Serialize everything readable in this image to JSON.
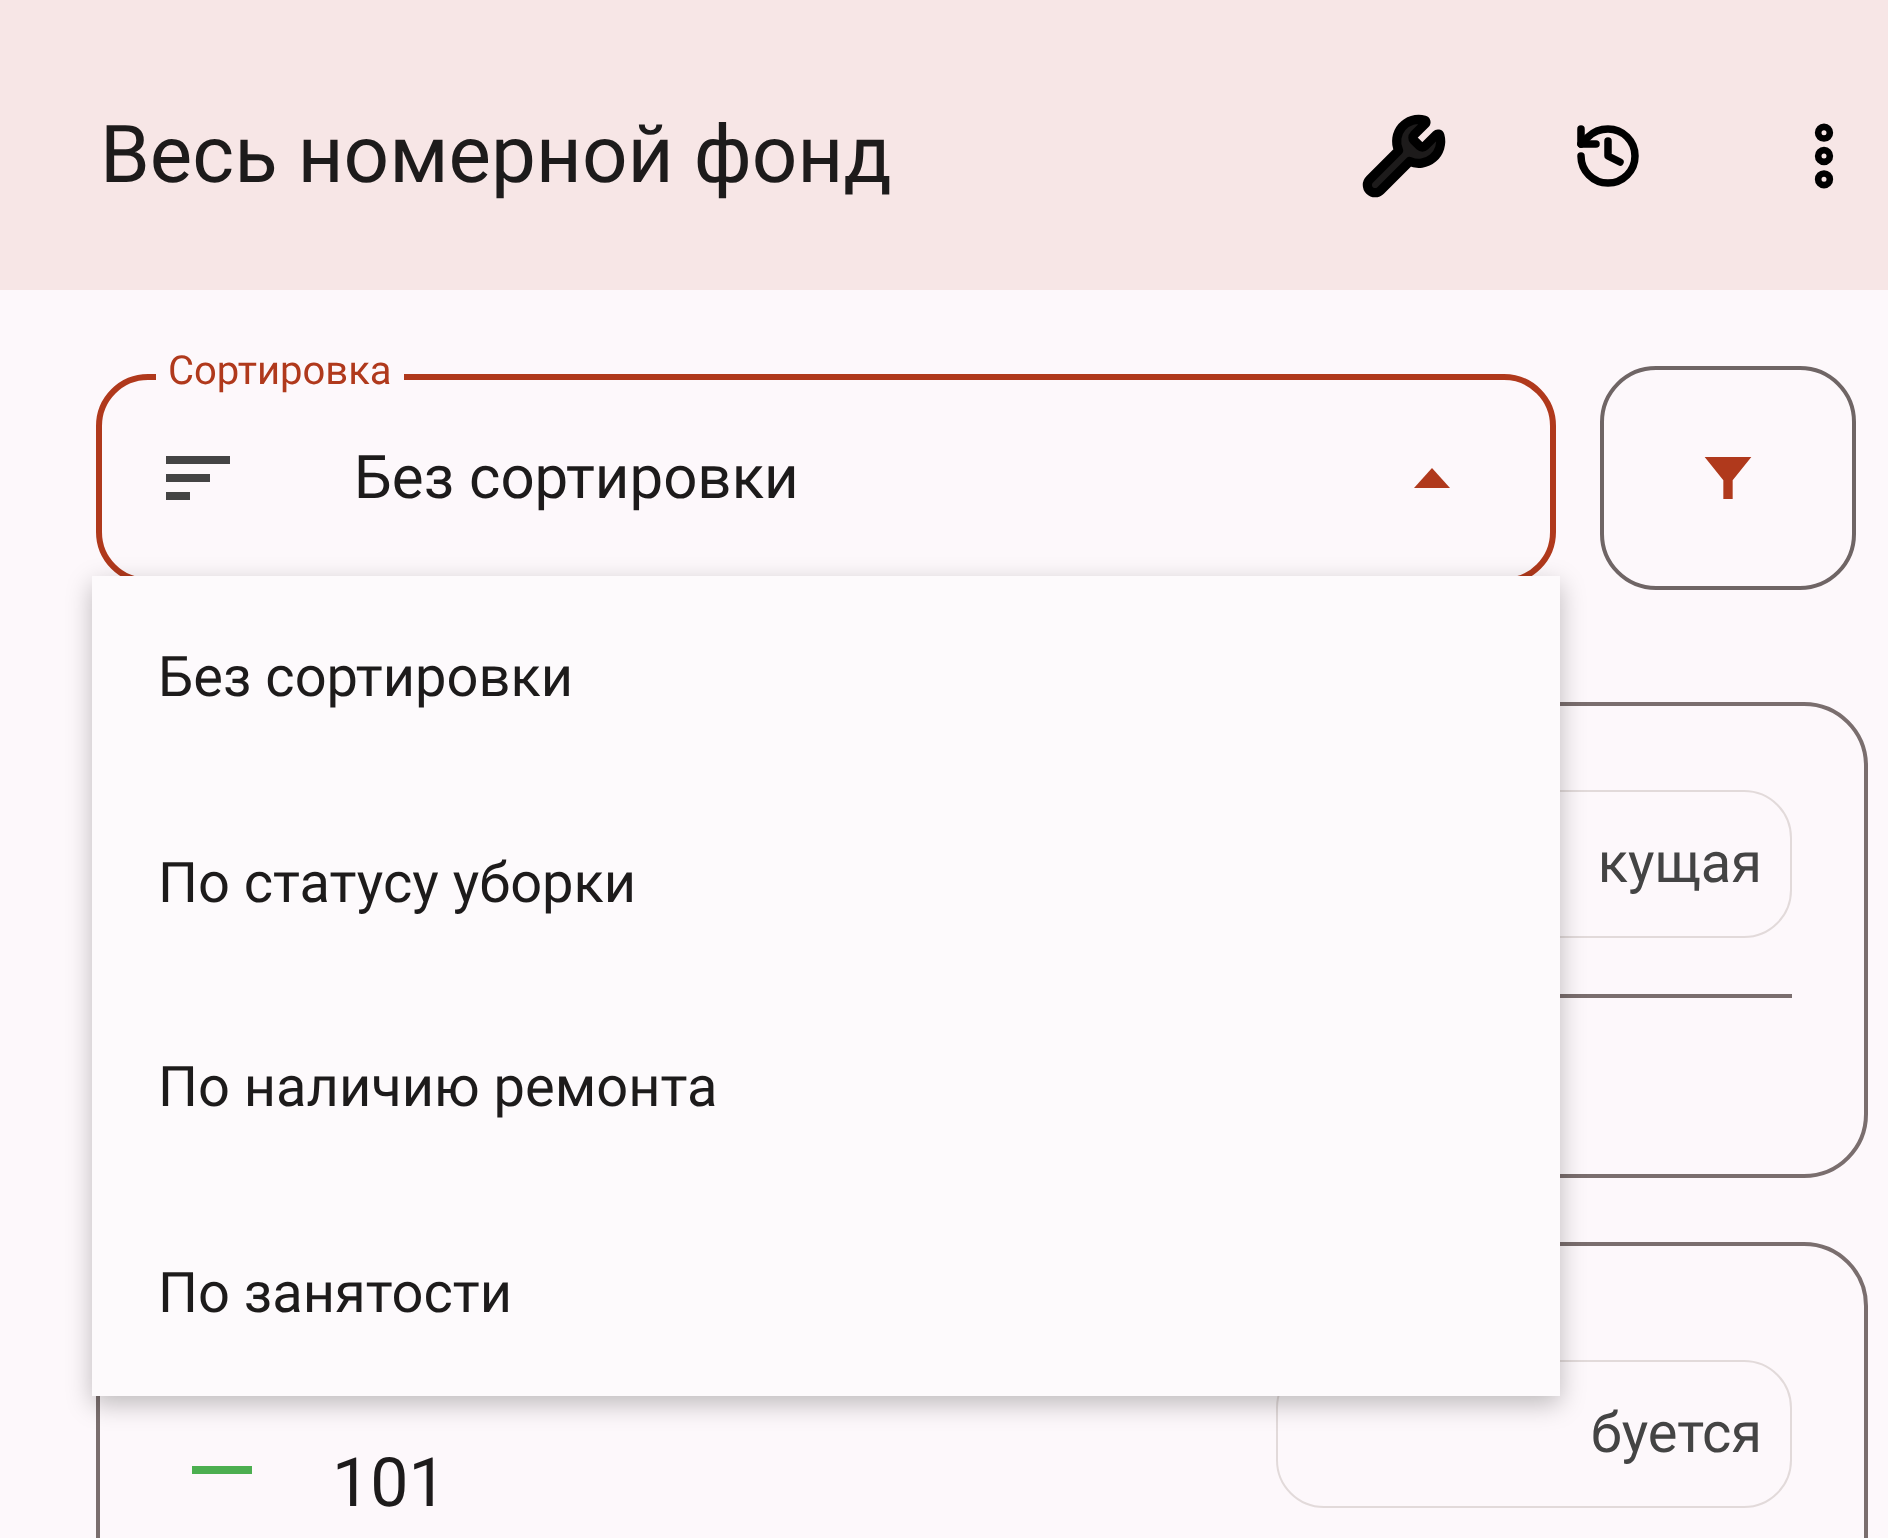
{
  "app_bar": {
    "title": "Весь номерной фонд"
  },
  "sort": {
    "label": "Сортировка",
    "value": "Без сортировки",
    "expanded": true,
    "options": [
      {
        "label": "Без сортировки"
      },
      {
        "label": "По статусу уборки"
      },
      {
        "label": "По наличию ремонта"
      },
      {
        "label": "По занятости"
      }
    ]
  },
  "rooms": [
    {
      "chip": "кущая"
    },
    {
      "number": "101",
      "color": "#4caf50",
      "chip": "буется"
    }
  ]
}
